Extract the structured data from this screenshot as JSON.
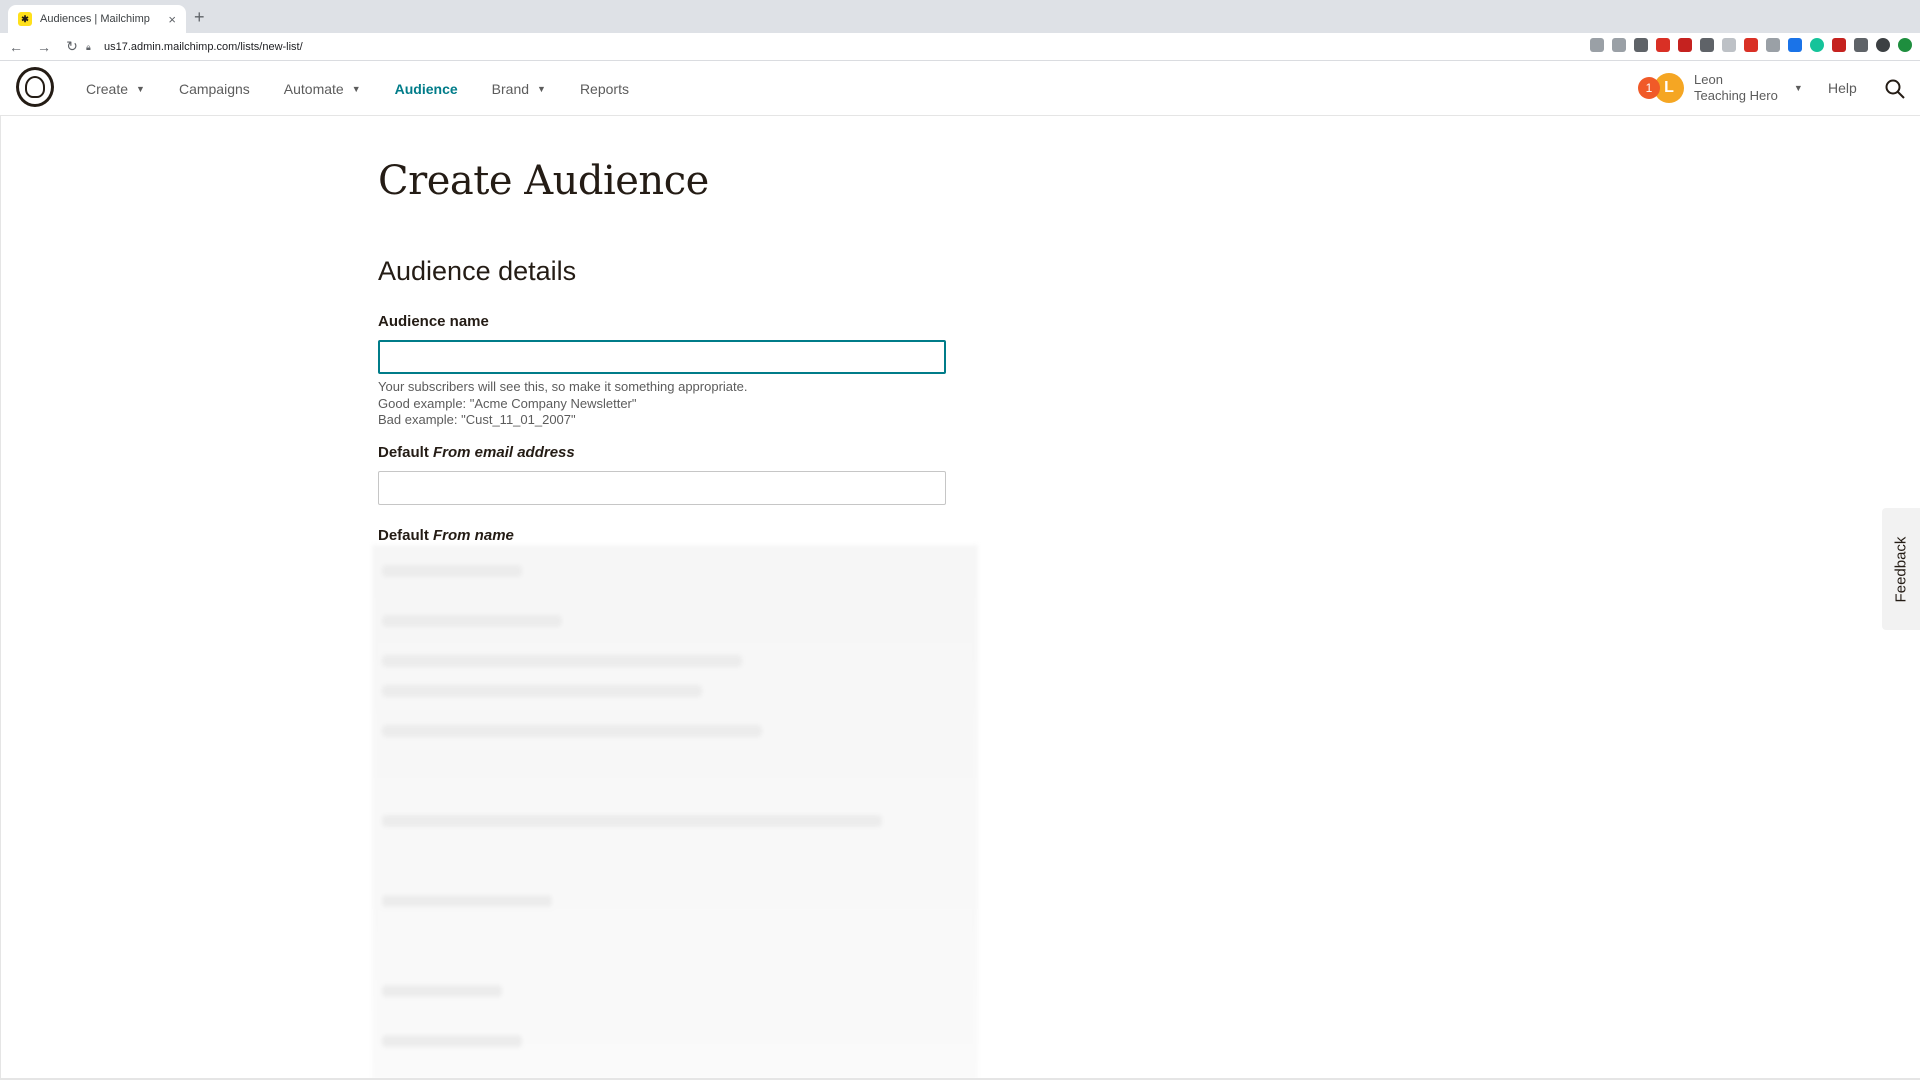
{
  "browser": {
    "tab_title": "Audiences | Mailchimp",
    "new_tab": "+",
    "tab_close": "×",
    "url": "us17.admin.mailchimp.com/lists/new-list/"
  },
  "nav": {
    "items": [
      {
        "label": "Create",
        "has_dropdown": true
      },
      {
        "label": "Campaigns",
        "has_dropdown": false
      },
      {
        "label": "Automate",
        "has_dropdown": true
      },
      {
        "label": "Audience",
        "has_dropdown": false,
        "active": true
      },
      {
        "label": "Brand",
        "has_dropdown": true
      },
      {
        "label": "Reports",
        "has_dropdown": false
      }
    ],
    "notification_count": "1",
    "avatar_initial": "L",
    "user_name": "Leon",
    "user_account": "Teaching Hero",
    "help_label": "Help"
  },
  "page": {
    "title": "Create Audience",
    "section_title": "Audience details",
    "audience_name_label": "Audience name",
    "audience_name_value": "",
    "hint_line1": "Your subscribers will see this, so make it something appropriate.",
    "hint_line2": "Good example: \"Acme Company Newsletter\"",
    "hint_line3": "Bad example: \"Cust_11_01_2007\"",
    "from_email_label_prefix": "Default ",
    "from_email_label_em": "From email address",
    "from_email_value": "",
    "from_name_label_prefix": "Default ",
    "from_name_label_em": "From name"
  },
  "feedback_label": "Feedback",
  "colors": {
    "accent": "#007c89",
    "notification": "#f05a28",
    "avatar": "#f5a623",
    "brand": "#ffe01b"
  }
}
